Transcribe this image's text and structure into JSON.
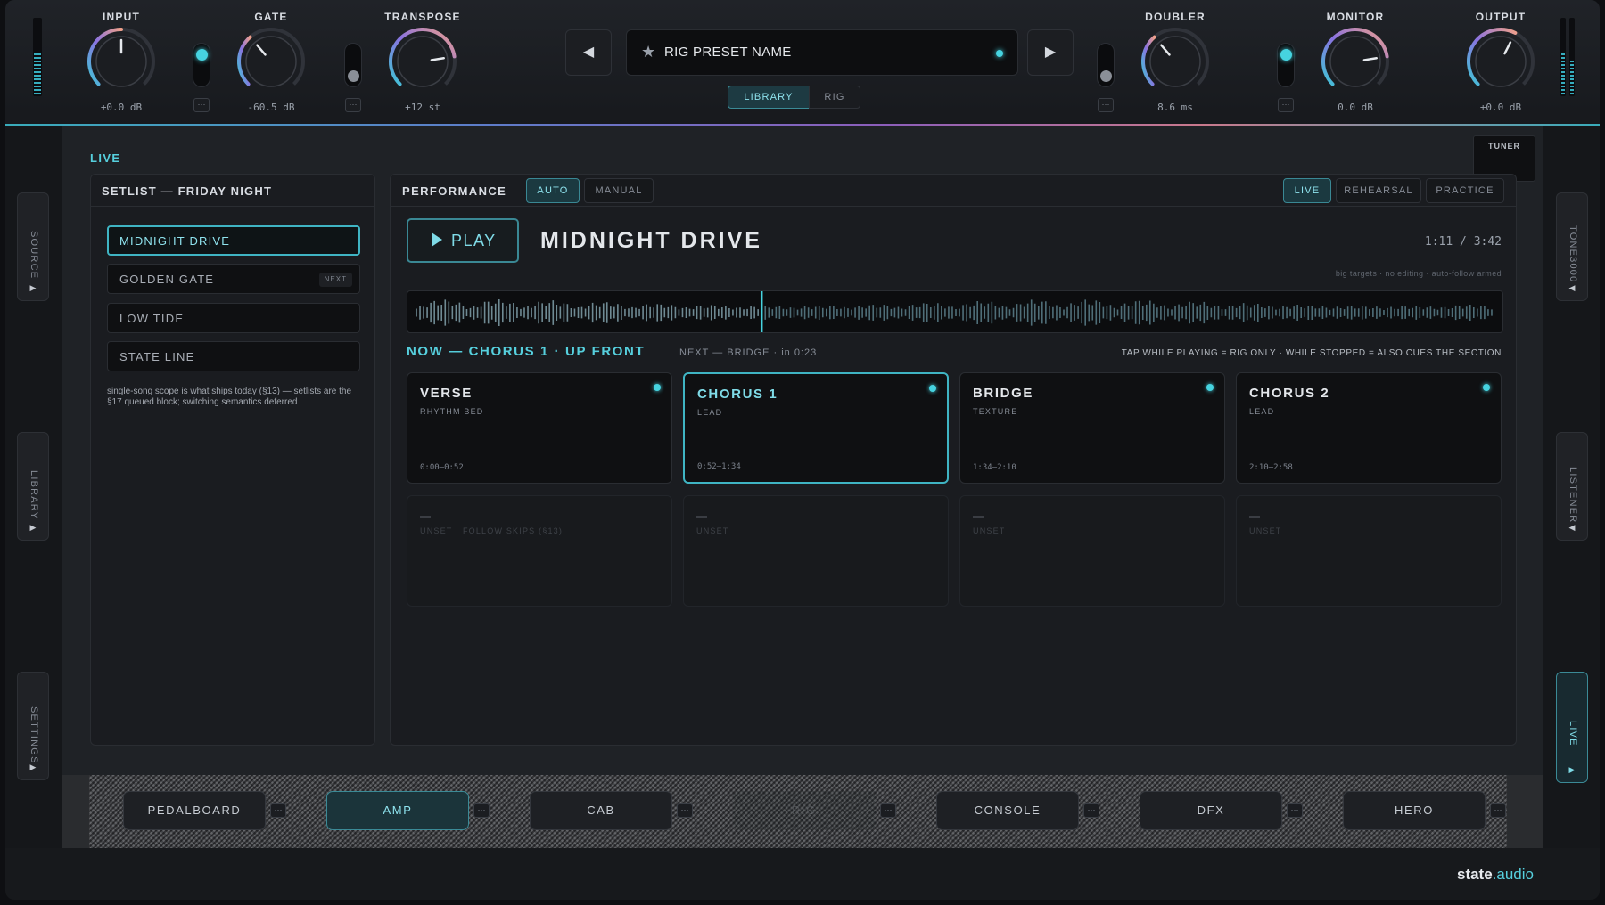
{
  "topbar": {
    "knobs": [
      {
        "id": "input",
        "label": "INPUT",
        "value": "+0.0 dB",
        "position": 0.5
      },
      {
        "id": "gate",
        "label": "GATE",
        "value": "-60.5 dB",
        "position": 0.35
      },
      {
        "id": "transpose",
        "label": "TRANSPOSE",
        "value": "+12 st",
        "position": 0.8
      },
      {
        "id": "doubler",
        "label": "DOUBLER",
        "value": "8.6 ms",
        "position": 0.35
      },
      {
        "id": "monitor",
        "label": "MONITOR",
        "value": "0.0 dB",
        "position": 0.8
      },
      {
        "id": "output",
        "label": "OUTPUT",
        "value": "+0.0 dB",
        "position": 0.6
      }
    ],
    "toggles": [
      {
        "id": "input-gate-toggle",
        "on": true
      },
      {
        "id": "transpose-toggle",
        "on": false
      },
      {
        "id": "doubler-toggle",
        "on": false
      },
      {
        "id": "monitor-toggle",
        "on": true
      }
    ],
    "mini_button_label": "···",
    "preset": {
      "name": "RIG PRESET NAME",
      "prev_symbol": "◀",
      "next_symbol": "▶",
      "star_symbol": "★"
    },
    "view_tabs": [
      {
        "label": "LIBRARY",
        "active": true
      },
      {
        "label": "RIG",
        "active": false
      }
    ]
  },
  "side_tabs": {
    "left": [
      {
        "label": "SOURCE"
      },
      {
        "label": "LIBRARY"
      },
      {
        "label": "SETTINGS"
      }
    ],
    "right": [
      {
        "label": "TONE3000"
      },
      {
        "label": "LISTENER"
      },
      {
        "label": "LIVE"
      }
    ]
  },
  "live": {
    "section_title": "LIVE",
    "tuner_label": "TUNER",
    "setlist": {
      "title": "SETLIST — FRIDAY NIGHT",
      "songs": [
        {
          "name": "MIDNIGHT DRIVE",
          "active": true,
          "tag": ""
        },
        {
          "name": "GOLDEN GATE",
          "active": false,
          "tag": "NEXT"
        },
        {
          "name": "LOW TIDE",
          "active": false,
          "tag": ""
        },
        {
          "name": "STATE LINE",
          "active": false,
          "tag": ""
        }
      ],
      "note": "single-song scope is what ships today (§13) — setlists are the §17 queued block; switching semantics deferred"
    },
    "performance": {
      "title": "PERFORMANCE",
      "mode_tabs": [
        {
          "label": "AUTO",
          "active": true
        },
        {
          "label": "MANUAL",
          "active": false
        }
      ],
      "context_tabs": [
        {
          "label": "LIVE",
          "active": true
        },
        {
          "label": "REHEARSAL",
          "active": false
        },
        {
          "label": "PRACTICE",
          "active": false
        }
      ],
      "play_label": "PLAY",
      "song_title": "MIDNIGHT DRIVE",
      "time": "1:11 / 3:42",
      "hint": "big targets · no editing · auto-follow armed",
      "playhead_fraction": 0.32,
      "now_label": "NOW — CHORUS 1 · UP FRONT",
      "next_label": "NEXT — BRIDGE · in 0:23",
      "tap_hint": "TAP WHILE PLAYING = RIG ONLY · WHILE STOPPED = ALSO CUES THE SECTION",
      "sections": [
        {
          "name": "VERSE",
          "role": "RHYTHM BED",
          "range": "0:00–0:52",
          "active": false
        },
        {
          "name": "CHORUS 1",
          "role": "LEAD",
          "range": "0:52–1:34",
          "active": true
        },
        {
          "name": "BRIDGE",
          "role": "TEXTURE",
          "range": "1:34–2:10",
          "active": false
        },
        {
          "name": "CHORUS 2",
          "role": "LEAD",
          "range": "2:10–2:58",
          "active": false
        }
      ],
      "empty_slots": [
        {
          "label": "UNSET · FOLLOW SKIPS (§13)"
        },
        {
          "label": "UNSET"
        },
        {
          "label": "UNSET"
        },
        {
          "label": "UNSET"
        }
      ]
    }
  },
  "ampbar": {
    "buttons": [
      {
        "label": "PEDALBOARD",
        "active": false,
        "faded": false
      },
      {
        "label": "AMP",
        "active": true,
        "faded": false
      },
      {
        "label": "CAB",
        "active": false,
        "faded": false
      },
      {
        "label": "RIG",
        "active": false,
        "faded": true
      },
      {
        "label": "CONSOLE",
        "active": false,
        "faded": false
      },
      {
        "label": "DFX",
        "active": false,
        "faded": false
      },
      {
        "label": "HERO",
        "active": false,
        "faded": false
      }
    ]
  },
  "brand": {
    "name": "state",
    "suffix": ".audio"
  },
  "colors": {
    "accent": "#46d3e0",
    "panel": "#1a1c20",
    "background": "#0e0f12"
  }
}
